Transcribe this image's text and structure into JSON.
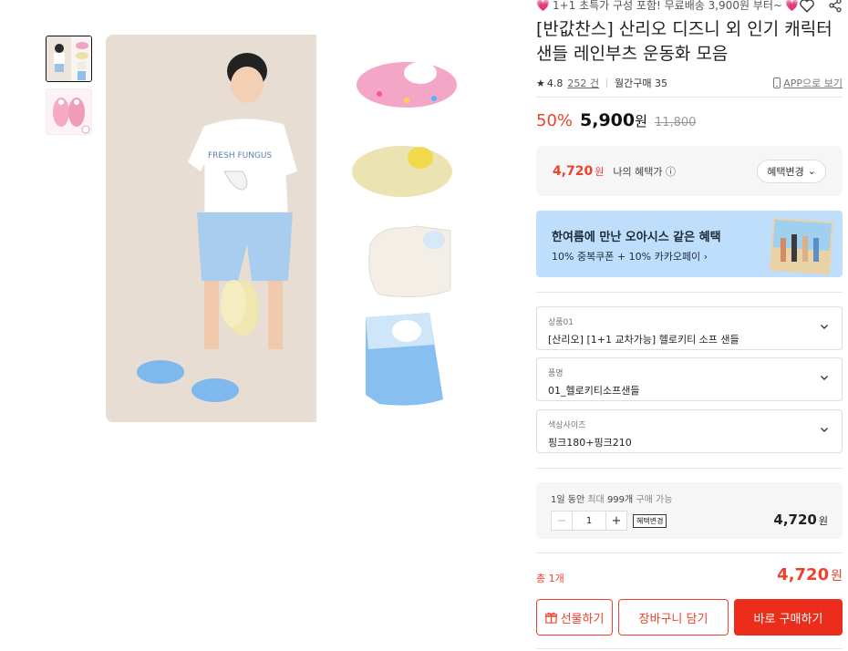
{
  "promo": {
    "heart_left": "💗",
    "text": "1+1 초특가 구성 포함! 무료배송 3,900원 부터~",
    "heart_right": "💗"
  },
  "title": "[반값찬스] 산리오 디즈니 외 인기 캐릭터 샌들 레인부츠 운동화 모음",
  "rating": {
    "score": "4.8",
    "review_count": "252 건",
    "monthly_purchases": "월간구매 35",
    "app_link": "APP으로 보기"
  },
  "price": {
    "discount": "50%",
    "amount": "5,900",
    "won": "원",
    "original": "11,800"
  },
  "benefit": {
    "price": "4,720",
    "won": "원",
    "label": "나의 혜택가",
    "change_button": "혜택변경"
  },
  "banner": {
    "title": "한여름에 만난 오아시스 같은 혜택",
    "subtitle": "10% 중복쿠폰 + 10% 카카오페이 ›"
  },
  "options": [
    {
      "label": "상품01",
      "value": "[산리오] [1+1 교차가능] 헬로키티 소프 샌들"
    },
    {
      "label": "품명",
      "value": "01_헬로키티소프샌들"
    },
    {
      "label": "색상사이즈",
      "value": "핑크180+핑크210"
    }
  ],
  "quantity": {
    "limit_prefix": "1일 동안",
    "limit_muted": "최대",
    "limit_count": "999개",
    "limit_suffix": "구매 가능",
    "value": "1",
    "tag": "혜택변경",
    "price": "4,720",
    "won": "원"
  },
  "total": {
    "label": "총 1개",
    "price": "4,720",
    "won": "원"
  },
  "buttons": {
    "gift": "선물하기",
    "cart": "장바구니 담기",
    "buy": "바로 구매하기"
  },
  "colors": {
    "accent": "#f0412c",
    "buy_button": "#ec2d1c",
    "banner_bg": "#bfdefb"
  }
}
